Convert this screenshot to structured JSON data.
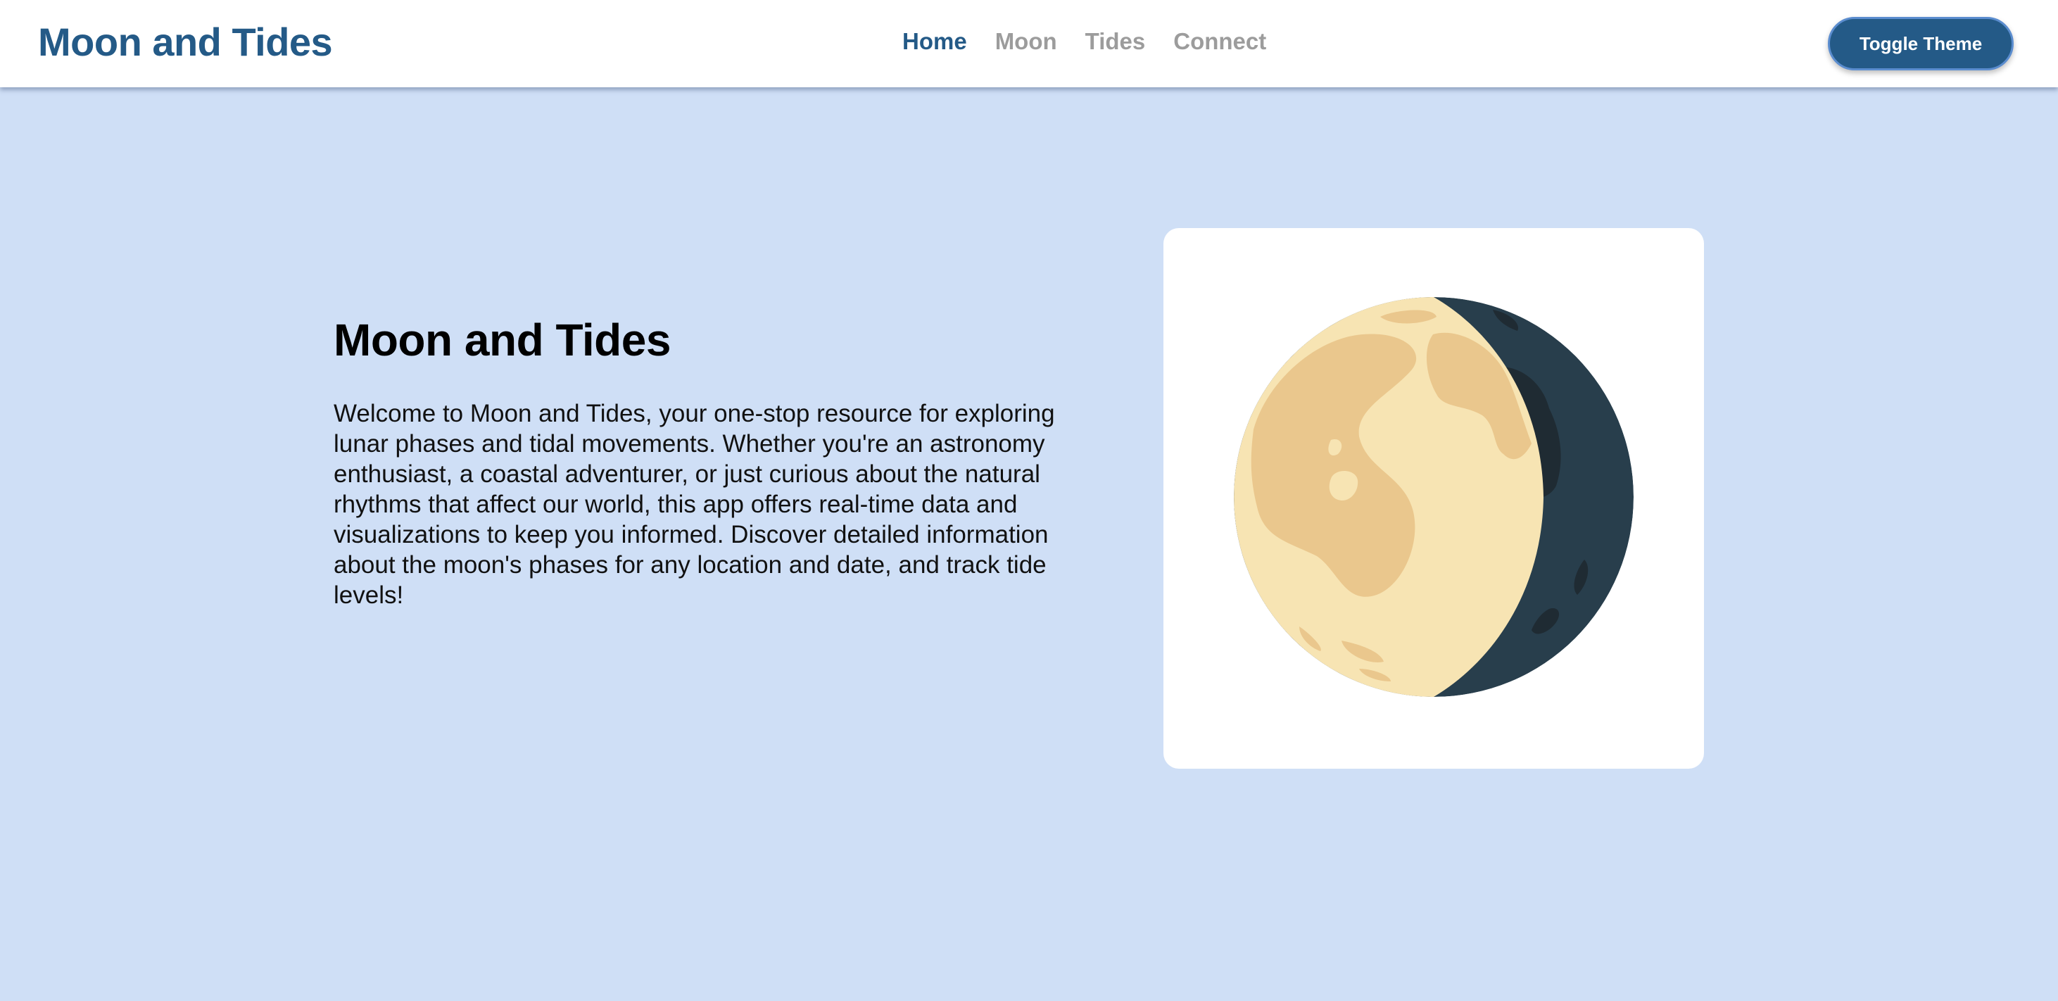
{
  "header": {
    "brand": "Moon and Tides",
    "nav": [
      "Home",
      "Moon",
      "Tides",
      "Connect"
    ],
    "active_nav": "Home",
    "toggle_theme_label": "Toggle Theme"
  },
  "hero": {
    "title": "Moon and Tides",
    "description": "Welcome to Moon and Tides, your one-stop resource for exploring lunar phases and tidal movements. Whether you're an astronomy enthusiast, a coastal adventurer, or just curious about the natural rhythms that affect our world, this app offers real-time data and visualizations to keep you informed. Discover detailed information about the moon's phases for any location and date, and track tide levels!",
    "image_icon": "waxing-gibbous-moon-icon"
  },
  "colors": {
    "page_background": "#cfdff6",
    "brand": "#245a87",
    "nav_inactive": "#9c9c9c",
    "moon_light": "#f7e4b3",
    "moon_crater": "#eac78d",
    "moon_shadow": "#283e4c"
  }
}
